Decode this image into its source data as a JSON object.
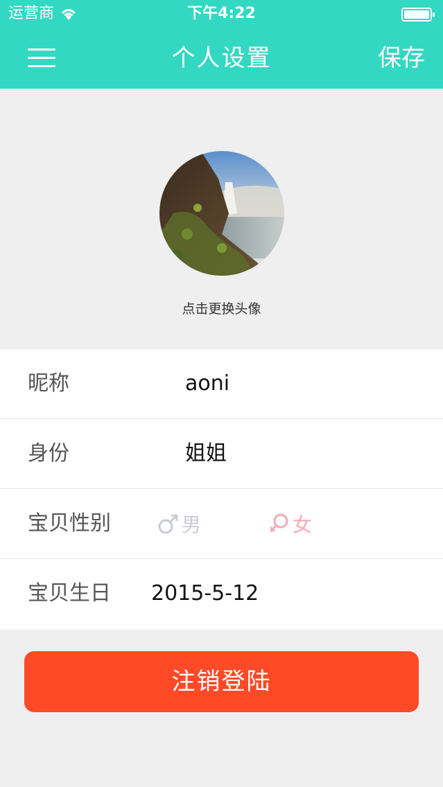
{
  "status_bar": {
    "carrier": "运营商",
    "time": "下午4:22"
  },
  "nav": {
    "title": "个人设置",
    "save_label": "保存"
  },
  "avatar": {
    "hint": "点击更换头像"
  },
  "form": {
    "nickname": {
      "label": "昵称",
      "value": "aoni"
    },
    "identity": {
      "label": "身份",
      "value": "姐姐"
    },
    "gender": {
      "label": "宝贝性别",
      "male": "男",
      "female": "女"
    },
    "birthday": {
      "label": "宝贝生日",
      "value": "2015-5-12"
    }
  },
  "logout_label": "注销登陆",
  "colors": {
    "accent": "#33d8c2",
    "logout": "#fe4a27",
    "background": "#efefef"
  }
}
